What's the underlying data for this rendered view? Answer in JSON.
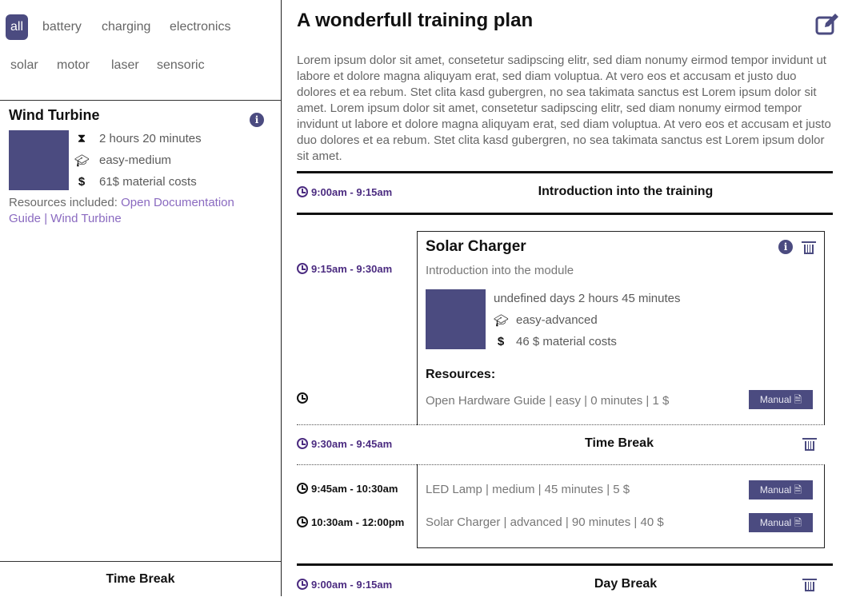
{
  "tags": [
    "all",
    "battery",
    "charging",
    "electronics",
    "solar",
    "motor",
    "laser",
    "sensoric"
  ],
  "sidebar_card": {
    "title": "Wind Turbine",
    "duration": "2 hours 20 minutes",
    "difficulty": "easy-medium",
    "cost": "61$ material costs",
    "resources_label": "Resources included:",
    "resource_link_1": "Open Documentation Guide",
    "separator": "|",
    "resource_link_2": "Wind Turbine"
  },
  "sidebar_break": "Time Break",
  "plan": {
    "title": "A wonderfull training plan",
    "description": "Lorem ipsum dolor sit amet, consetetur sadipscing elitr, sed diam nonumy eirmod tempor invidunt ut labore et dolore magna aliquyam erat, sed diam voluptua. At vero eos et accusam et justo duo dolores et ea rebum. Stet clita kasd gubergren, no sea takimata sanctus est Lorem ipsum dolor sit amet. Lorem ipsum dolor sit amet, consetetur sadipscing elitr, sed diam nonumy eirmod tempor invidunt ut labore et dolore magna aliquyam erat, sed diam voluptua. At vero eos et accusam et justo duo dolores et ea rebum. Stet clita kasd gubergren, no sea takimata sanctus est Lorem ipsum dolor sit amet."
  },
  "slots": {
    "intro_time": "9:00am - 9:15am",
    "intro_title": "Introduction into the training",
    "module_time": "9:15am - 9:30am",
    "break_time": "9:30am - 9:45am",
    "break_title": "Time Break",
    "group_time_1": "9:45am - 10:30am",
    "group_time_2": "10:30am - 12:00pm",
    "daybreak_time": "9:00am - 9:15am",
    "daybreak_title": "Day Break"
  },
  "module": {
    "title": "Solar Charger",
    "subtitle": "Introduction into the module",
    "duration": "undefined days 2 hours 45 minutes",
    "difficulty": "easy-advanced",
    "cost": "46 $ material costs",
    "resources_heading": "Resources:",
    "resource": "Open Hardware Guide | easy | 0 minutes | 1 $",
    "manual_label": "Manual"
  },
  "group": {
    "item_1": "LED Lamp | medium | 45 minutes | 5 $",
    "item_2": "Solar Charger | advanced | 90 minutes | 40 $",
    "manual_label": "Manual"
  },
  "colors": {
    "accent": "#4b4b80",
    "time": "#4b2b80",
    "link": "#8a6ac0"
  },
  "icons": [
    "info-icon",
    "hourglass-icon",
    "graduation-cap-icon",
    "dollar-icon",
    "clock-icon",
    "trash-icon",
    "edit-icon",
    "file-download-icon"
  ]
}
